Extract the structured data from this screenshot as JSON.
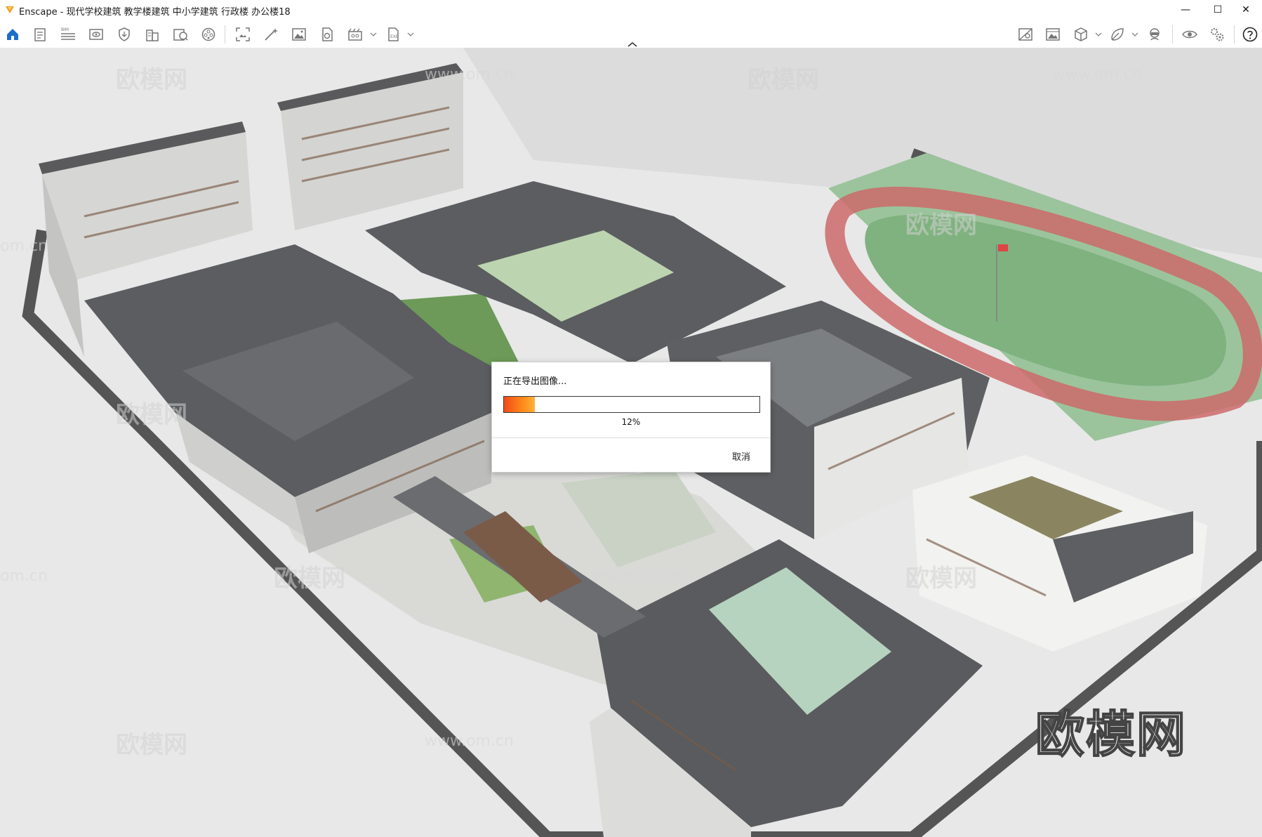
{
  "window": {
    "title": "Enscape - 现代学校建筑 教学楼建筑 中小学建筑 行政楼 办公楼18",
    "minimize": "—",
    "maximize": "☐",
    "close": "✕"
  },
  "toolbar": {
    "left_icons": [
      "home-icon",
      "document-icon",
      "bim-list-icon",
      "view-icon",
      "visual-settings-icon",
      "building-icon",
      "asset-library-icon",
      "materials-icon",
      "screenshot-icon",
      "batch-render-icon",
      "image-export-icon",
      "panorama-icon",
      "video-icon",
      "export-icon"
    ],
    "right_icons": [
      "map-icon",
      "gallery-icon",
      "cube-view-icon",
      "collaboration-icon",
      "vr-headset-icon",
      "visibility-icon",
      "settings-icon",
      "help-icon"
    ],
    "accent": "#1e6ec8"
  },
  "viewport": {
    "watermark_text": "欧模网",
    "watermark_url": "www.om.cn",
    "watermark_partial": "om.cn"
  },
  "dialog": {
    "message": "正在导出图像...",
    "progress_percent_text": "12%",
    "progress_fraction": 0.12,
    "cancel_label": "取消"
  }
}
